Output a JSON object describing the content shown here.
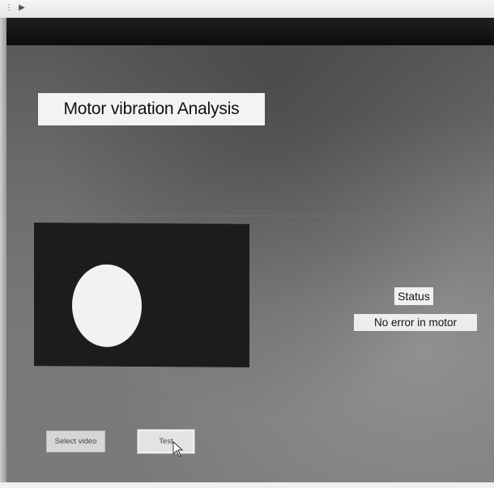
{
  "app": {
    "title": "Motor vibration Analysis"
  },
  "top_bar": {
    "nav_icons": [
      "chevron-left-icon",
      "play-right-icon"
    ]
  },
  "video_preview": {
    "background_color": "#1c1c1c",
    "shape": "ellipse",
    "shape_color": "#f2f2f2"
  },
  "status": {
    "label": "Status",
    "value": "No error in motor"
  },
  "buttons": {
    "select_video_label": "Select video",
    "test_label": "Test"
  },
  "cursor": {
    "icon": "mouse-pointer-icon"
  }
}
